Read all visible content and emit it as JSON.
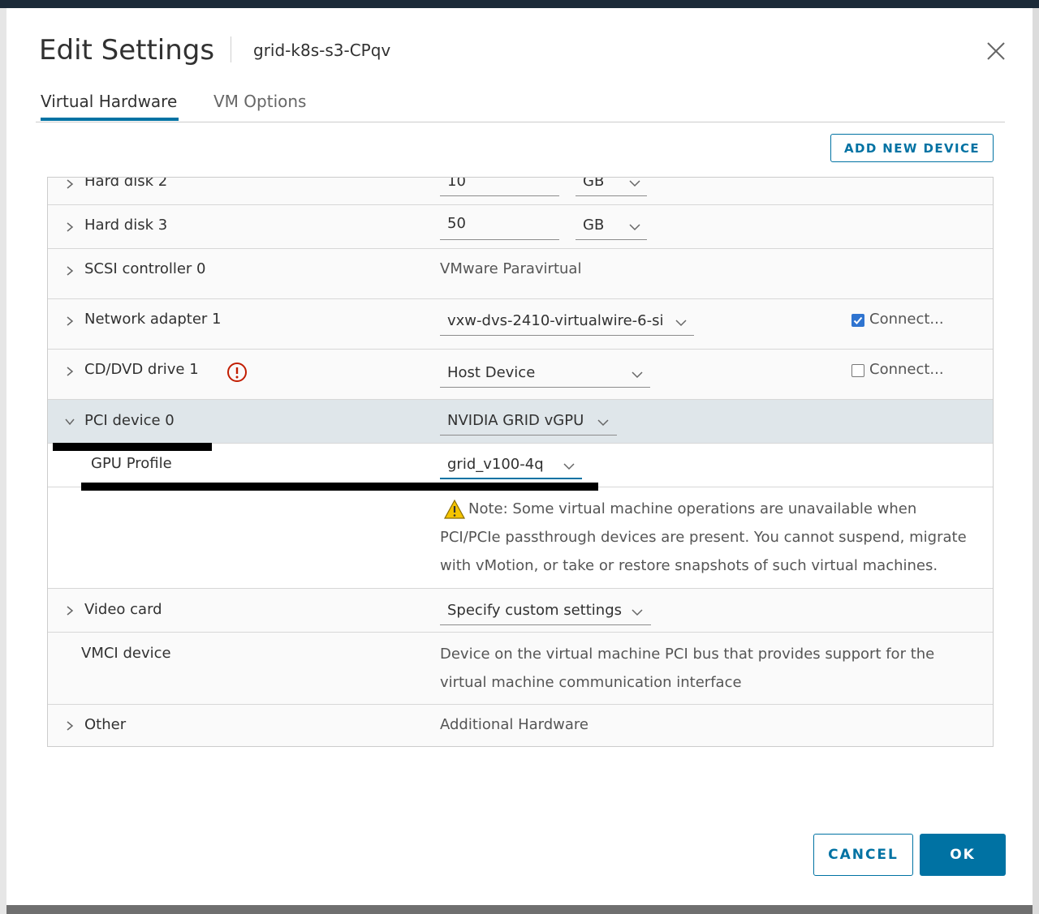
{
  "dialog": {
    "title": "Edit Settings",
    "vm_name": "grid-k8s-s3-CPqv"
  },
  "tabs": [
    {
      "label": "Virtual Hardware",
      "active": true
    },
    {
      "label": "VM Options",
      "active": false
    }
  ],
  "add_device_label": "ADD NEW DEVICE",
  "hardware": {
    "hard_disk_2": {
      "label": "Hard disk 2",
      "size": "10",
      "unit": "GB"
    },
    "hard_disk_3": {
      "label": "Hard disk 3",
      "size": "50",
      "unit": "GB"
    },
    "scsi": {
      "label": "SCSI controller 0",
      "value": "VMware Paravirtual"
    },
    "network": {
      "label": "Network adapter 1",
      "value": "vxw-dvs-2410-virtualwire-6-si",
      "connect_label": "Connect...",
      "connected": true
    },
    "cdrom": {
      "label": "CD/DVD drive 1",
      "value": "Host Device",
      "connect_label": "Connect...",
      "connected": false
    },
    "pci": {
      "label": "PCI device 0",
      "value": "NVIDIA GRID vGPU"
    },
    "gpu_profile": {
      "label": "GPU Profile",
      "value": "grid_v100-4q"
    },
    "pci_note": {
      "line1": "Note: Some virtual machine operations are unavailable when",
      "line2": "PCI/PCIe passthrough devices are present. You cannot suspend, migrate",
      "line3": "with vMotion, or take or restore snapshots of such virtual machines."
    },
    "video": {
      "label": "Video card",
      "value": "Specify custom settings"
    },
    "vmci": {
      "label": "VMCI device",
      "line1": "Device on the virtual machine PCI bus that provides support for the",
      "line2": "virtual machine communication interface"
    },
    "other": {
      "label": "Other",
      "value": "Additional Hardware"
    }
  },
  "footer": {
    "cancel_label": "CANCEL",
    "ok_label": "OK"
  },
  "colors": {
    "accent": "#0072a3",
    "warning_red": "#c21d00",
    "warning_yellow": "#f5c400",
    "selected_row": "#dfe6ea"
  }
}
